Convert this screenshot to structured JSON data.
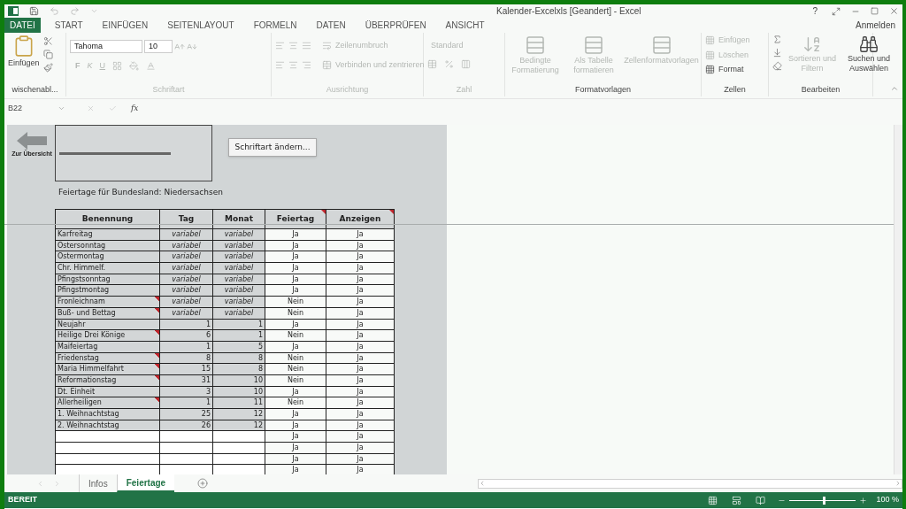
{
  "window": {
    "title": "Kalender-Excelxls [Geandert] - Excel",
    "help": "?"
  },
  "ribbon_tabs": [
    {
      "label": "DATEI",
      "selected": true
    },
    {
      "label": "START",
      "selected": false
    },
    {
      "label": "EINFÜGEN",
      "selected": false
    },
    {
      "label": "SEITENLAYOUT",
      "selected": false
    },
    {
      "label": "FORMELN",
      "selected": false
    },
    {
      "label": "DATEN",
      "selected": false
    },
    {
      "label": "ÜBERPRÜFEN",
      "selected": false
    },
    {
      "label": "ANSICHT",
      "selected": false
    }
  ],
  "account": "Anmelden",
  "ribbon": {
    "clipboard": {
      "paste": "Einfügen",
      "label": "wischenabl..."
    },
    "font": {
      "name": "Tahoma",
      "size": "10",
      "bold": "F",
      "italic": "K",
      "underline": "U",
      "label": "Schriftart",
      "disabled": true
    },
    "alignment": {
      "wrap": "Zeilenumbruch",
      "merge": "Verbinden und zentrieren",
      "label": "Ausrichtung",
      "disabled": true
    },
    "number": {
      "format": "Standard",
      "label": "Zahl",
      "disabled": true
    },
    "styles": {
      "label": "Formatvorlagen",
      "items": [
        {
          "label": "Bedingte Formatierung",
          "disabled": true
        },
        {
          "label": "Als Tabelle formatieren",
          "disabled": true
        },
        {
          "label": "Zellenformatvorlagen",
          "disabled": true
        }
      ]
    },
    "cells": {
      "label": "Zellen",
      "items": [
        {
          "label": "Einfügen",
          "disabled": true
        },
        {
          "label": "Löschen",
          "disabled": true
        },
        {
          "label": "Format",
          "disabled": false
        }
      ]
    },
    "editing": {
      "label": "Bearbeiten",
      "items": [
        {
          "label": "Sortieren und Filtern",
          "disabled": true
        },
        {
          "label": "Suchen und Auswählen",
          "disabled": false
        }
      ]
    }
  },
  "formula_bar": {
    "name_box": "B22",
    "fx": "fx"
  },
  "sheet": {
    "back_link": "Zur Übersicht",
    "font_button": "Schriftart ändern...",
    "caption": "Feiertage für Bundesland: Niedersachsen",
    "columns": [
      {
        "label": "Benennung",
        "comment": false
      },
      {
        "label": "Tag",
        "comment": false
      },
      {
        "label": "Monat",
        "comment": false
      },
      {
        "label": "Feiertag",
        "comment": true
      },
      {
        "label": "Anzeigen",
        "comment": true
      }
    ],
    "rows": [
      {
        "kind": "variable",
        "name": "Karfreitag",
        "day": "variabel",
        "month": "variabel",
        "holiday": "Ja",
        "show": "Ja",
        "comment": false
      },
      {
        "kind": "variable",
        "name": "Ostersonntag",
        "day": "variabel",
        "month": "variabel",
        "holiday": "Ja",
        "show": "Ja",
        "comment": false
      },
      {
        "kind": "variable",
        "name": "Ostermontag",
        "day": "variabel",
        "month": "variabel",
        "holiday": "Ja",
        "show": "Ja",
        "comment": false
      },
      {
        "kind": "variable",
        "name": "Chr. Himmelf.",
        "day": "variabel",
        "month": "variabel",
        "holiday": "Ja",
        "show": "Ja",
        "comment": false
      },
      {
        "kind": "variable",
        "name": "Pfingstsonntag",
        "day": "variabel",
        "month": "variabel",
        "holiday": "Ja",
        "show": "Ja",
        "comment": false
      },
      {
        "kind": "variable",
        "name": "Pfingstmontag",
        "day": "variabel",
        "month": "variabel",
        "holiday": "Ja",
        "show": "Ja",
        "comment": false
      },
      {
        "kind": "variable",
        "name": "Fronleichnam",
        "day": "variabel",
        "month": "variabel",
        "holiday": "Nein",
        "show": "Ja",
        "comment": true
      },
      {
        "kind": "variable",
        "name": "Buß- und Bettag",
        "day": "variabel",
        "month": "variabel",
        "holiday": "Nein",
        "show": "Ja",
        "comment": true
      },
      {
        "kind": "fixed",
        "name": "Neujahr",
        "day": "1",
        "month": "1",
        "holiday": "Ja",
        "show": "Ja",
        "comment": false
      },
      {
        "kind": "fixed",
        "name": "Heilige Drei Könige",
        "day": "6",
        "month": "1",
        "holiday": "Nein",
        "show": "Ja",
        "comment": true
      },
      {
        "kind": "fixed",
        "name": "Maifeiertag",
        "day": "1",
        "month": "5",
        "holiday": "Ja",
        "show": "Ja",
        "comment": false
      },
      {
        "kind": "fixed",
        "name": "Friedenstag",
        "day": "8",
        "month": "8",
        "holiday": "Nein",
        "show": "Ja",
        "comment": true
      },
      {
        "kind": "fixed",
        "name": "Maria Himmelfahrt",
        "day": "15",
        "month": "8",
        "holiday": "Nein",
        "show": "Ja",
        "comment": true
      },
      {
        "kind": "fixed",
        "name": "Reformationstag",
        "day": "31",
        "month": "10",
        "holiday": "Nein",
        "show": "Ja",
        "comment": true
      },
      {
        "kind": "fixed",
        "name": "Dt. Einheit",
        "day": "3",
        "month": "10",
        "holiday": "Ja",
        "show": "Ja",
        "comment": false
      },
      {
        "kind": "fixed",
        "name": "Allerheiligen",
        "day": "1",
        "month": "11",
        "holiday": "Nein",
        "show": "Ja",
        "comment": true
      },
      {
        "kind": "fixed",
        "name": "1. Weihnachtstag",
        "day": "25",
        "month": "12",
        "holiday": "Ja",
        "show": "Ja",
        "comment": false
      },
      {
        "kind": "fixed",
        "name": "2. Weihnachtstag",
        "day": "26",
        "month": "12",
        "holiday": "Ja",
        "show": "Ja",
        "comment": false
      },
      {
        "kind": "empty",
        "holiday": "Ja",
        "show": "Ja",
        "comment": false
      },
      {
        "kind": "empty",
        "holiday": "Ja",
        "show": "Ja",
        "comment": false
      },
      {
        "kind": "empty",
        "holiday": "Ja",
        "show": "Ja",
        "comment": false
      },
      {
        "kind": "empty",
        "holiday": "Ja",
        "show": "Ja",
        "comment": false
      }
    ]
  },
  "sheet_tabs": [
    {
      "label": "Infos",
      "selected": false
    },
    {
      "label": "Feiertage",
      "selected": true
    }
  ],
  "status_bar": {
    "status": "BEREIT",
    "zoom": {
      "level": 0.5,
      "reading": "100 %"
    }
  }
}
